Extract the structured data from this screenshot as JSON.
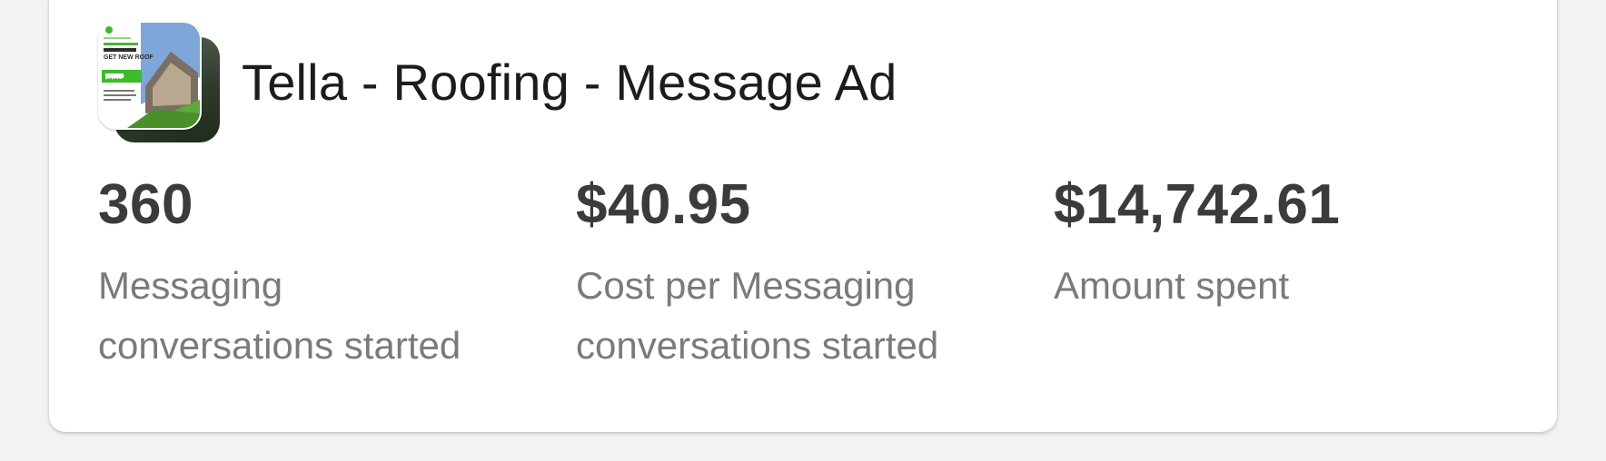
{
  "ad": {
    "title": "Tella - Roofing - Message Ad",
    "thumbnail_text": {
      "headline": "GET NEW ROOF",
      "price": "$7,995*"
    }
  },
  "metrics": [
    {
      "value": "360",
      "label": "Messaging conversations started"
    },
    {
      "value": "$40.95",
      "label": "Cost per Messaging conversations started"
    },
    {
      "value": "$14,742.61",
      "label": "Amount spent"
    }
  ],
  "colors": {
    "accent_green": "#3dbb2b",
    "title_text": "#1c1c1c",
    "value_text": "#3b3b3b",
    "label_text": "#7a7a7a"
  }
}
